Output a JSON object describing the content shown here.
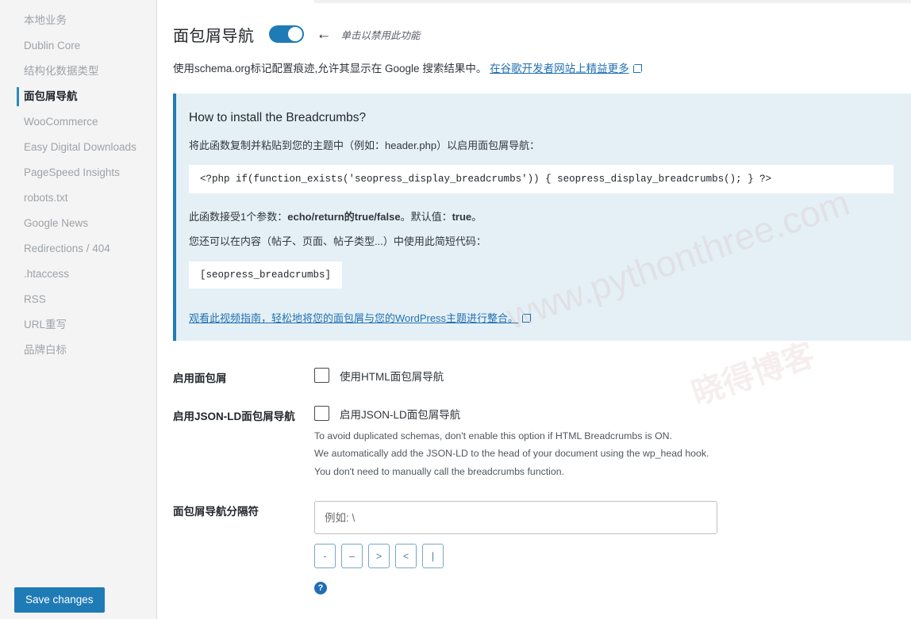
{
  "sidebar": {
    "items": [
      {
        "label": "本地业务",
        "active": false
      },
      {
        "label": "Dublin Core",
        "active": false
      },
      {
        "label": "结构化数据类型",
        "active": false
      },
      {
        "label": "面包屑导航",
        "active": true
      },
      {
        "label": "WooCommerce",
        "active": false
      },
      {
        "label": "Easy Digital Downloads",
        "active": false
      },
      {
        "label": "PageSpeed Insights",
        "active": false
      },
      {
        "label": "robots.txt",
        "active": false
      },
      {
        "label": "Google News",
        "active": false
      },
      {
        "label": "Redirections / 404",
        "active": false
      },
      {
        "label": ".htaccess",
        "active": false
      },
      {
        "label": "RSS",
        "active": false
      },
      {
        "label": "URL重写",
        "active": false
      },
      {
        "label": "品牌白标",
        "active": false
      }
    ],
    "save_label": "Save changes"
  },
  "header": {
    "title": "面包屑导航",
    "toggle_state": "on",
    "arrow": "←",
    "toggle_hint": "单击以禁用此功能",
    "intro_text": "使用schema.org标记配置痕迹,允许其显示在 Google 搜索结果中。",
    "intro_link": "在谷歌开发者网站上精益更多"
  },
  "notice": {
    "heading": "How to install the Breadcrumbs?",
    "paragraph1": "将此函数复制并粘贴到您的主题中（例如：header.php）以启用面包屑导航：",
    "code": "<?php if(function_exists('seopress_display_breadcrumbs')) { seopress_display_breadcrumbs(); } ?>",
    "paragraph2_pre": "此函数接受1个参数：",
    "paragraph2_b1": "echo/return的true/false",
    "paragraph2_mid": "。默认值：",
    "paragraph2_b2": "true",
    "paragraph2_end": "。",
    "paragraph3": "您还可以在内容（帖子、页面、帖子类型...）中使用此简短代码：",
    "shortcode": "[seopress_breadcrumbs]",
    "video_link": "观看此视频指南，轻松地将您的面包屑与您的WordPress主题进行整合。"
  },
  "settings": {
    "enable_breadcrumbs": {
      "label": "启用面包屑",
      "checkbox_label": "使用HTML面包屑导航",
      "checked": false
    },
    "enable_jsonld": {
      "label": "启用JSON-LD面包屑导航",
      "checkbox_label": "启用JSON-LD面包屑导航",
      "checked": false,
      "help": [
        "To avoid duplicated schemas, don't enable this option if HTML Breadcrumbs is ON.",
        "We automatically add the JSON-LD to the head of your document using the wp_head hook.",
        "You don't need to manually call the breadcrumbs function."
      ]
    },
    "separator": {
      "label": "面包屑导航分隔符",
      "value": "",
      "placeholder": "例如: \\",
      "buttons": [
        "-",
        "–",
        ">",
        "<",
        "|"
      ],
      "help_icon": "?"
    }
  },
  "watermark": {
    "line1": "www.pythonthree.com",
    "line2": "晓得博客"
  },
  "colors": {
    "accent": "#1f7bb6",
    "notice_bg": "#e5f0f6",
    "link": "#2271b1",
    "sidebar_bg": "#f4f4f4"
  }
}
